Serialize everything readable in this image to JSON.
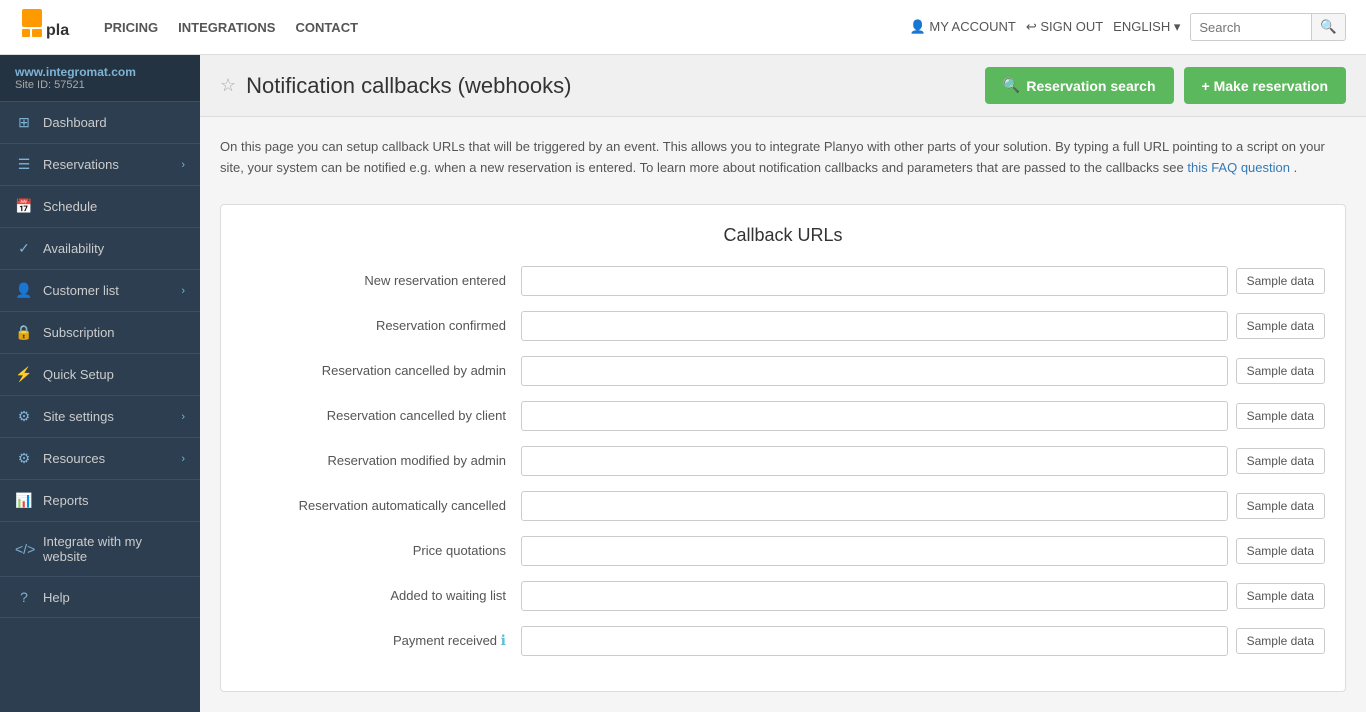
{
  "topNav": {
    "logo_text": "planyo",
    "links": [
      "PRICING",
      "INTEGRATIONS",
      "CONTACT"
    ],
    "my_account": "MY ACCOUNT",
    "sign_out": "SIGN OUT",
    "language": "ENGLISH",
    "search_placeholder": "Search"
  },
  "sidebar": {
    "site_url": "www.integromat.com",
    "site_id": "Site ID: 57521",
    "items": [
      {
        "id": "dashboard",
        "label": "Dashboard",
        "icon": "⊞",
        "has_arrow": false
      },
      {
        "id": "reservations",
        "label": "Reservations",
        "icon": "☰",
        "has_arrow": true
      },
      {
        "id": "schedule",
        "label": "Schedule",
        "icon": "📅",
        "has_arrow": false
      },
      {
        "id": "availability",
        "label": "Availability",
        "icon": "✓",
        "has_arrow": false
      },
      {
        "id": "customer-list",
        "label": "Customer list",
        "icon": "👤",
        "has_arrow": true
      },
      {
        "id": "subscription",
        "label": "Subscription",
        "icon": "🔒",
        "has_arrow": false
      },
      {
        "id": "quick-setup",
        "label": "Quick Setup",
        "icon": "⚡",
        "has_arrow": false
      },
      {
        "id": "site-settings",
        "label": "Site settings",
        "icon": "⚙",
        "has_arrow": true
      },
      {
        "id": "resources",
        "label": "Resources",
        "icon": "⚙",
        "has_arrow": true
      },
      {
        "id": "reports",
        "label": "Reports",
        "icon": "📊",
        "has_arrow": false
      },
      {
        "id": "integrate",
        "label": "Integrate with my website",
        "icon": "</>",
        "has_arrow": false
      },
      {
        "id": "help",
        "label": "Help",
        "icon": "?",
        "has_arrow": false
      }
    ]
  },
  "pageHeader": {
    "title": "Notification callbacks (webhooks)",
    "reservation_search_btn": "Reservation search",
    "make_reservation_btn": "+ Make reservation"
  },
  "description": {
    "text_before_link": "On this page you can setup callback URLs that will be triggered by an event. This allows you to integrate Planyo with other parts of your solution. By typing a full URL pointing to a script on your site, your system can be notified e.g. when a new reservation is entered. To learn more about notification callbacks and parameters that are passed to the callbacks see ",
    "link_text": "this FAQ question",
    "text_after_link": "."
  },
  "callbackSection": {
    "title": "Callback URLs",
    "rows": [
      {
        "id": "new-reservation",
        "label": "New reservation entered",
        "has_info": false
      },
      {
        "id": "reservation-confirmed",
        "label": "Reservation confirmed",
        "has_info": false
      },
      {
        "id": "reservation-cancelled-admin",
        "label": "Reservation cancelled by admin",
        "has_info": false
      },
      {
        "id": "reservation-cancelled-client",
        "label": "Reservation cancelled by client",
        "has_info": false
      },
      {
        "id": "reservation-modified-admin",
        "label": "Reservation modified by admin",
        "has_info": false
      },
      {
        "id": "reservation-auto-cancelled",
        "label": "Reservation automatically cancelled",
        "has_info": false
      },
      {
        "id": "price-quotations",
        "label": "Price quotations",
        "has_info": false
      },
      {
        "id": "added-to-waiting",
        "label": "Added to waiting list",
        "has_info": false
      },
      {
        "id": "payment-received",
        "label": "Payment received",
        "has_info": true
      }
    ],
    "sample_data_btn": "Sample data"
  }
}
